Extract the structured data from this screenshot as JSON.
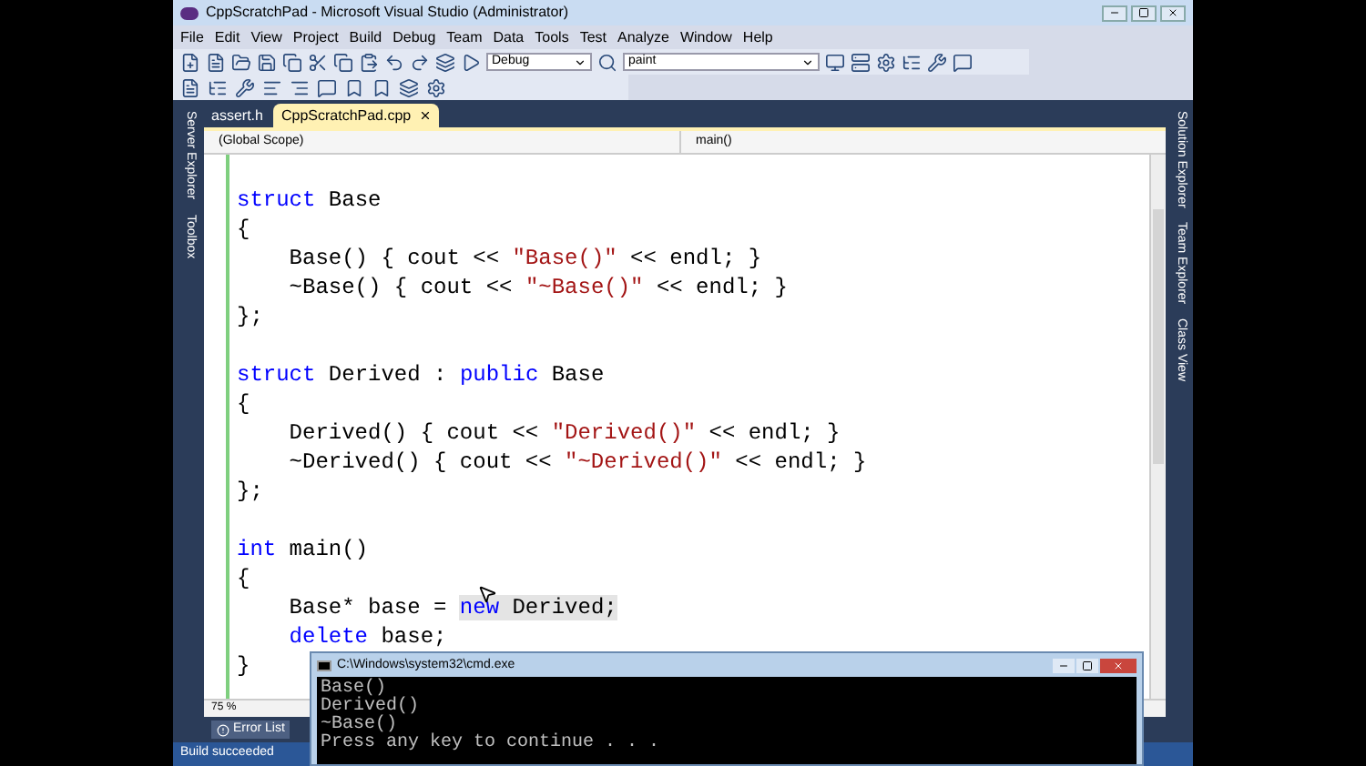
{
  "window": {
    "title": "CppScratchPad - Microsoft Visual Studio (Administrator)"
  },
  "menu": [
    "File",
    "Edit",
    "View",
    "Project",
    "Build",
    "Debug",
    "Team",
    "Data",
    "Tools",
    "Test",
    "Analyze",
    "Window",
    "Help"
  ],
  "toolbar": {
    "configuration": "Debug",
    "find": "paint"
  },
  "left_rail": [
    "Server Explorer",
    "Toolbox"
  ],
  "right_rail": [
    "Solution Explorer",
    "Team Explorer",
    "Class View"
  ],
  "tabs": [
    {
      "label": "assert.h",
      "selected": false
    },
    {
      "label": "CppScratchPad.cpp",
      "selected": true
    }
  ],
  "scope_bar": {
    "scope": "(Global Scope)",
    "member": "main()"
  },
  "code": [
    {
      "kind": "blank"
    },
    {
      "kind": "code",
      "tokens": [
        {
          "text": "struct",
          "kind": "keyword"
        },
        {
          "text": " Base",
          "kind": "plain"
        }
      ]
    },
    {
      "kind": "code",
      "tokens": [
        {
          "text": "{",
          "kind": "plain"
        }
      ]
    },
    {
      "kind": "code",
      "tokens": [
        {
          "text": "    Base() { cout << ",
          "kind": "plain"
        },
        {
          "text": "\"Base()\"",
          "kind": "string"
        },
        {
          "text": " << endl; }",
          "kind": "plain"
        }
      ]
    },
    {
      "kind": "code",
      "tokens": [
        {
          "text": "    ~Base() { cout << ",
          "kind": "plain"
        },
        {
          "text": "\"~Base()\"",
          "kind": "string"
        },
        {
          "text": " << endl; }",
          "kind": "plain"
        }
      ]
    },
    {
      "kind": "code",
      "tokens": [
        {
          "text": "};",
          "kind": "plain"
        }
      ]
    },
    {
      "kind": "blank"
    },
    {
      "kind": "code",
      "tokens": [
        {
          "text": "struct",
          "kind": "keyword"
        },
        {
          "text": " Derived : ",
          "kind": "plain"
        },
        {
          "text": "public",
          "kind": "keyword"
        },
        {
          "text": " Base",
          "kind": "plain"
        }
      ]
    },
    {
      "kind": "code",
      "tokens": [
        {
          "text": "{",
          "kind": "plain"
        }
      ]
    },
    {
      "kind": "code",
      "tokens": [
        {
          "text": "    Derived() { cout << ",
          "kind": "plain"
        },
        {
          "text": "\"Derived()\"",
          "kind": "string"
        },
        {
          "text": " << endl; }",
          "kind": "plain"
        }
      ]
    },
    {
      "kind": "code",
      "tokens": [
        {
          "text": "    ~Derived() { cout << ",
          "kind": "plain"
        },
        {
          "text": "\"~Derived()\"",
          "kind": "string"
        },
        {
          "text": " << endl; }",
          "kind": "plain"
        }
      ]
    },
    {
      "kind": "code",
      "tokens": [
        {
          "text": "};",
          "kind": "plain"
        }
      ]
    },
    {
      "kind": "blank"
    },
    {
      "kind": "code",
      "tokens": [
        {
          "text": "int",
          "kind": "keyword"
        },
        {
          "text": " main()",
          "kind": "plain"
        }
      ]
    },
    {
      "kind": "code",
      "tokens": [
        {
          "text": "{",
          "kind": "plain"
        }
      ]
    },
    {
      "kind": "code",
      "tokens": [
        {
          "text": "    Base* base = ",
          "kind": "plain",
          "highlighted": false
        },
        {
          "text": "new",
          "kind": "keyword",
          "highlighted": true
        },
        {
          "text": " Derived;",
          "kind": "plain",
          "highlighted": true
        }
      ]
    },
    {
      "kind": "code",
      "tokens": [
        {
          "text": "    delete",
          "kind": "keyword"
        },
        {
          "text": " base;",
          "kind": "plain"
        }
      ]
    },
    {
      "kind": "code",
      "tokens": [
        {
          "text": "}",
          "kind": "plain"
        }
      ]
    }
  ],
  "zoom": "75 %",
  "bottom_tabs": [
    {
      "label": "Error List"
    }
  ],
  "status_bar": "Build succeeded",
  "console": {
    "title": "C:\\Windows\\system32\\cmd.exe",
    "lines": [
      "Base()",
      "Derived()",
      "~Base()",
      "Press any key to continue . . ."
    ]
  }
}
